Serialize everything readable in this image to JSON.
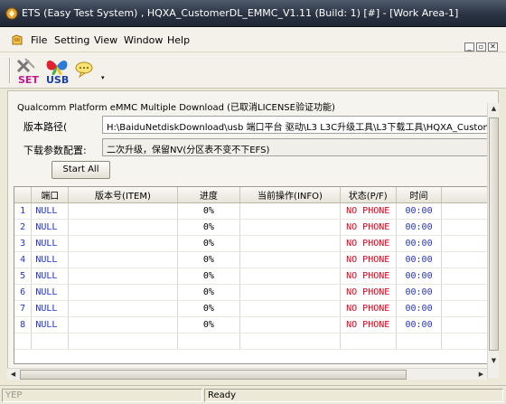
{
  "window": {
    "title": "ETS (Easy Test System) , HQXA_CustomerDL_EMMC_V1.11 (Build: 1) [#] - [Work Area-1]"
  },
  "menu": {
    "items": [
      "File",
      "Setting",
      "View",
      "Window",
      "Help"
    ]
  },
  "toolbar": {
    "set_label": "SET",
    "usb_label": "USB",
    "dropdown_glyph": "▾"
  },
  "panel": {
    "title": "Qualcomm Platform eMMC Multiple Download (已取消LICENSE验证功能)",
    "path_label": "版本路径(",
    "path_value": "H:\\BaiduNetdiskDownload\\usb 端口平台 驱动\\L3 L3C升级工具\\L3下载工具\\HQXA_CustomerDL_EMM",
    "config_label": "下载参数配置:",
    "config_value": "二次升级，保留NV(分区表不变不下EFS)",
    "start_button": "Start All"
  },
  "table": {
    "columns": [
      "",
      "端口",
      "版本号(ITEM)",
      "进度",
      "当前操作(INFO)",
      "状态(P/F)",
      "时间",
      ""
    ],
    "rows": [
      {
        "idx": "1",
        "port": "NULL",
        "version": "",
        "progress": "0%",
        "info": "",
        "status": "NO PHONE",
        "time": "00:00"
      },
      {
        "idx": "2",
        "port": "NULL",
        "version": "",
        "progress": "0%",
        "info": "",
        "status": "NO PHONE",
        "time": "00:00"
      },
      {
        "idx": "3",
        "port": "NULL",
        "version": "",
        "progress": "0%",
        "info": "",
        "status": "NO PHONE",
        "time": "00:00"
      },
      {
        "idx": "4",
        "port": "NULL",
        "version": "",
        "progress": "0%",
        "info": "",
        "status": "NO PHONE",
        "time": "00:00"
      },
      {
        "idx": "5",
        "port": "NULL",
        "version": "",
        "progress": "0%",
        "info": "",
        "status": "NO PHONE",
        "time": "00:00"
      },
      {
        "idx": "6",
        "port": "NULL",
        "version": "",
        "progress": "0%",
        "info": "",
        "status": "NO PHONE",
        "time": "00:00"
      },
      {
        "idx": "7",
        "port": "NULL",
        "version": "",
        "progress": "0%",
        "info": "",
        "status": "NO PHONE",
        "time": "00:00"
      },
      {
        "idx": "8",
        "port": "NULL",
        "version": "",
        "progress": "0%",
        "info": "",
        "status": "NO PHONE",
        "time": "00:00"
      }
    ]
  },
  "statusbar": {
    "left": "YEP",
    "right": "Ready"
  },
  "colors": {
    "status_red": "#e0001a",
    "index_blue": "#2233cc",
    "title_bar": "#2a3342"
  }
}
